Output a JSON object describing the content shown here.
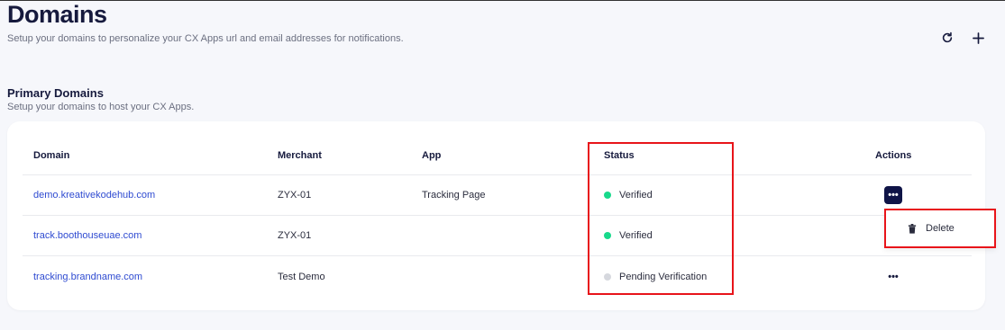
{
  "header": {
    "title": "Domains",
    "subtitle": "Setup your domains to personalize your CX Apps url and email addresses for notifications."
  },
  "section": {
    "title": "Primary Domains",
    "subtitle": "Setup your domains to host your CX Apps."
  },
  "table": {
    "columns": [
      "Domain",
      "Merchant",
      "App",
      "Status",
      "Actions"
    ],
    "rows": [
      {
        "domain": "demo.kreativekodehub.com",
        "merchant": "ZYX-01",
        "app": "Tracking Page",
        "status": "Verified",
        "status_color": "#18d98b"
      },
      {
        "domain": "track.boothouseuae.com",
        "merchant": "ZYX-01",
        "app": "",
        "status": "Verified",
        "status_color": "#18d98b"
      },
      {
        "domain": "tracking.brandname.com",
        "merchant": "Test Demo",
        "app": "",
        "status": "Pending Verification",
        "status_color": "#d6d8de"
      }
    ],
    "actions_glyph": "•••"
  },
  "dropdown": {
    "delete_label": "Delete"
  },
  "icons": {
    "refresh": "refresh-icon",
    "add": "plus-icon",
    "delete": "trash-icon"
  },
  "colors": {
    "accent": "#0f1447",
    "link": "#2f4bd1",
    "highlight": "#e8141a"
  }
}
